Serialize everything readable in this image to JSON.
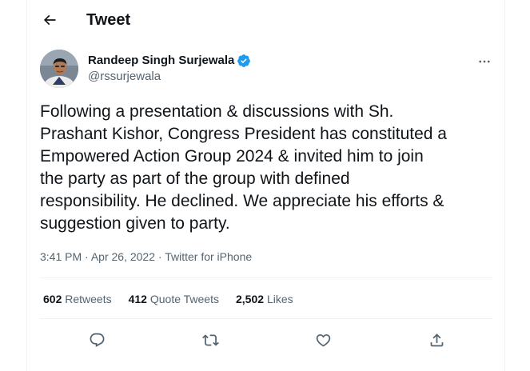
{
  "header": {
    "back_icon": "arrow-left-icon",
    "title": "Tweet"
  },
  "author": {
    "name": "Randeep Singh Surjewala",
    "handle": "@rssurjewala",
    "verified_icon": "verified-badge-icon",
    "verified_color": "#1d9bf0"
  },
  "more_icon": "more-horizontal-icon",
  "tweet": {
    "text": "Following a presentation & discussions with Sh.\nPrashant Kishor, Congress President has constituted a\nEmpowered Action Group 2024 & invited him to join\nthe party as part of the group with defined\nresponsibility. He declined. We appreciate his efforts &\nsuggestion given to party.",
    "time": "3:41 PM",
    "separator": "·",
    "date": "Apr 26, 2022",
    "source": "Twitter for iPhone"
  },
  "stats": {
    "retweets_count": "602",
    "retweets_label": "Retweets",
    "quote_count": "412",
    "quote_label": "Quote Tweets",
    "likes_count": "2,502",
    "likes_label": "Likes"
  },
  "actions": {
    "reply_icon": "reply-icon",
    "retweet_icon": "retweet-icon",
    "like_icon": "heart-icon",
    "share_icon": "share-icon"
  },
  "colors": {
    "text_primary": "#0f1419",
    "text_secondary": "#536471",
    "border": "#eff3f4"
  }
}
